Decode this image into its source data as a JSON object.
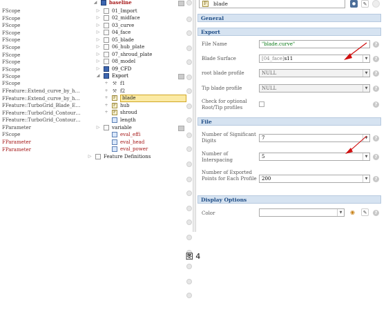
{
  "type_column": [
    {
      "text": "FScope"
    },
    {
      "text": "FScope"
    },
    {
      "text": "FScope"
    },
    {
      "text": "FScope"
    },
    {
      "text": "FScope"
    },
    {
      "text": "FScope"
    },
    {
      "text": "FScope"
    },
    {
      "text": "FScope"
    },
    {
      "text": "FScope"
    },
    {
      "text": "FScope"
    },
    {
      "text": "FScope"
    },
    {
      "text": "FFeature::Extend_curve_by_h…"
    },
    {
      "text": "FFeature::Extend_curve_by_h…"
    },
    {
      "text": "FFeature::TurboGrid_Blade_E…"
    },
    {
      "text": "FFeature::TurboGrid_Contour…"
    },
    {
      "text": "FFeature::TurboGrid_Contour…"
    },
    {
      "text": "FParameter"
    },
    {
      "text": "FScope"
    },
    {
      "text": "FParameter",
      "red": true
    },
    {
      "text": "FParameter",
      "red": true
    },
    {
      "text": "FParameter",
      "red": true
    }
  ],
  "tree": {
    "root": "baseline",
    "items": [
      {
        "label": "01_Import"
      },
      {
        "label": "02_midface"
      },
      {
        "label": "03_curve"
      },
      {
        "label": "04_face"
      },
      {
        "label": "05_blade"
      },
      {
        "label": "06_hub_plate"
      },
      {
        "label": "07_shroud_plate"
      },
      {
        "label": "08_model"
      },
      {
        "label": "09_CFD"
      },
      {
        "label": "Export"
      },
      {
        "label": "f1"
      },
      {
        "label": "f2"
      },
      {
        "label": "blade"
      },
      {
        "label": "hub"
      },
      {
        "label": "shroud"
      },
      {
        "label": "length"
      },
      {
        "label": "variable"
      },
      {
        "label": "eval_effi"
      },
      {
        "label": "eval_head"
      },
      {
        "label": "eval_power"
      },
      {
        "label": "Feature Definitions"
      }
    ]
  },
  "panel": {
    "object_name": "blade",
    "sections": {
      "general": "General",
      "export": "Export",
      "file": "File",
      "display": "Display Options"
    },
    "file_name_label": "File Name",
    "file_name_value": "\"blade.curve\"",
    "blade_surface_label": "Blade Surface",
    "blade_surface_prefix": "[04_face]",
    "blade_surface_value": "s11",
    "root_profile_label": "root blade profile",
    "root_profile_value": "NULL",
    "tip_profile_label": "Tip blade profile",
    "tip_profile_value": "NULL",
    "check_label": "Check for optional Root/Tip profiles",
    "sig_digits_label": "Number of Significant Digits",
    "sig_digits_value": "7",
    "interspacing_label": "Number of Interspacing",
    "interspacing_value": "5",
    "exported_points_label": "Number of Exported Points for Each Profile",
    "exported_points_value": "200",
    "color_label": "Color",
    "color_value": ""
  },
  "caption": "图 4",
  "colors": {
    "section_bg": "#d6e3f1",
    "highlight": "#fbeaa4",
    "arrow": "#d01010",
    "param_red": "#a51616"
  }
}
